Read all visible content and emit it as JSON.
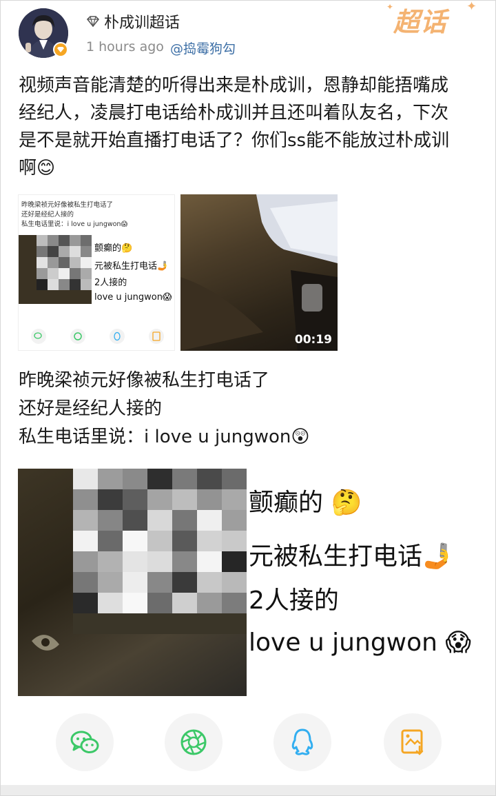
{
  "post": {
    "username": "朴成训超话",
    "timestamp": "1 hours ago",
    "mention": "@捣霉狗勾",
    "supertopic_logo": "超话",
    "text_lines": [
      "视频声音能清楚的听得出来是朴成训，恩静却能捂嘴成",
      "经纪人，凌晨打电话给朴成训并且还叫着队友名，下次",
      "是不是就开始直播打电话了？你们ss能不能放过朴成训",
      "啊😊"
    ]
  },
  "thumbnails": {
    "left_caption_lines": [
      "昨晚梁祯元好像被私生打电话了",
      "还好是经纪人接的",
      "私生电话里说：i love u jungwon😱"
    ],
    "left_overlay_lines": [
      "颤癫的🤔",
      "元被私生打电话🤳",
      "2人接的",
      "love u jungwon😱"
    ],
    "video_duration": "00:19"
  },
  "caption": {
    "lines": [
      "昨晚梁祯元好像被私生打电话了",
      "还好是经纪人接的",
      "私生电话里说：i love u jungwon😲"
    ]
  },
  "big_image": {
    "lines": [
      "颤癫的 🤔",
      "元被私生打电话🤳",
      "2人接的",
      "love u jungwon 😱"
    ]
  },
  "share": {
    "buttons": [
      "wechat-share",
      "moments-share",
      "qq-share",
      "save-image"
    ]
  },
  "colors": {
    "accent_logo": "#f4b372",
    "mention_link": "#3d6fa6",
    "wechat_green": "#3cc868",
    "qq_blue": "#32aef0",
    "save_orange": "#f5a623"
  }
}
